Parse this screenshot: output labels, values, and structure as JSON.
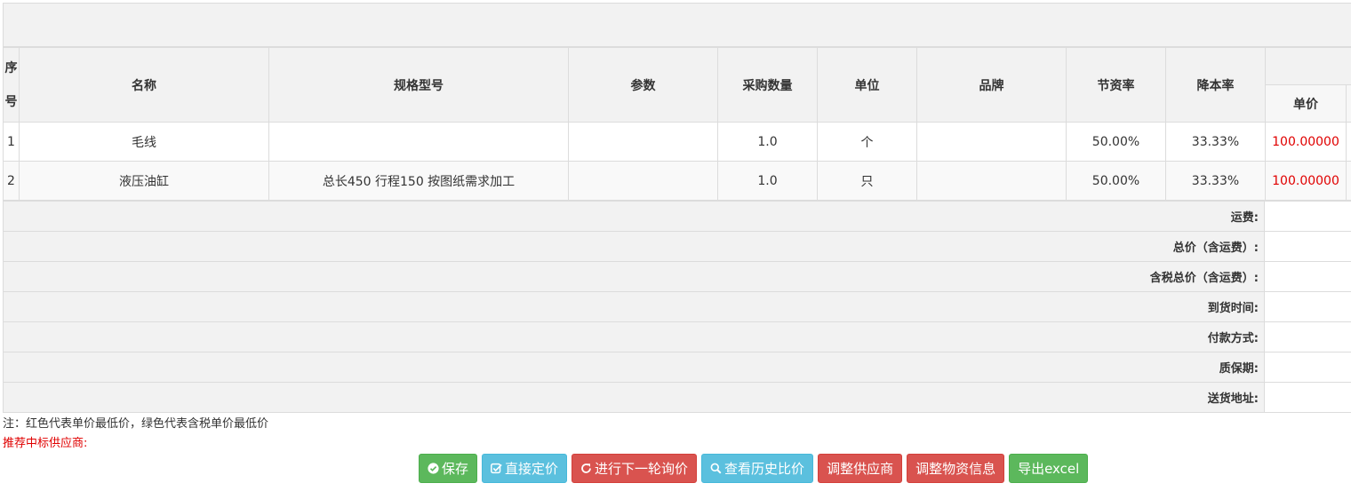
{
  "table": {
    "headers": {
      "seq": "序号",
      "name": "名称",
      "spec": "规格型号",
      "param": "参数",
      "qty": "采购数量",
      "unit": "单位",
      "brand": "品牌",
      "save_rate": "节资率",
      "reduce_rate": "降本率",
      "unit_price": "单价"
    },
    "rows": [
      {
        "seq": "1",
        "name": "毛线",
        "spec": "",
        "param": "",
        "qty": "1.0",
        "unit": "个",
        "brand": "",
        "save_rate": "50.00%",
        "reduce_rate": "33.33%",
        "price": "100.00000"
      },
      {
        "seq": "2",
        "name": "液压油缸",
        "spec": "总长450 行程150 按图纸需求加工",
        "param": "",
        "qty": "1.0",
        "unit": "只",
        "brand": "",
        "save_rate": "50.00%",
        "reduce_rate": "33.33%",
        "price": "100.00000"
      }
    ]
  },
  "summary": {
    "freight": "运费:",
    "total_with_freight": "总价（含运费）:",
    "tax_total_with_freight": "含税总价（含运费）:",
    "delivery_time": "到货时间:",
    "payment_method": "付款方式:",
    "warranty": "质保期:",
    "delivery_address": "送货地址:"
  },
  "note": "注：红色代表单价最低价，绿色代表含税单价最低价",
  "recommended_label": "推荐中标供应商:",
  "buttons": {
    "save": "保存",
    "direct_price": "直接定价",
    "next_round": "进行下一轮询价",
    "history": "查看历史比价",
    "adjust_supplier": "调整供应商",
    "adjust_material": "调整物资信息",
    "export": "导出excel"
  },
  "colors": {
    "lowest_price": "#e00000",
    "btn_green": "#5cb85c",
    "btn_blue": "#5bc0de",
    "btn_red": "#d9534f"
  }
}
